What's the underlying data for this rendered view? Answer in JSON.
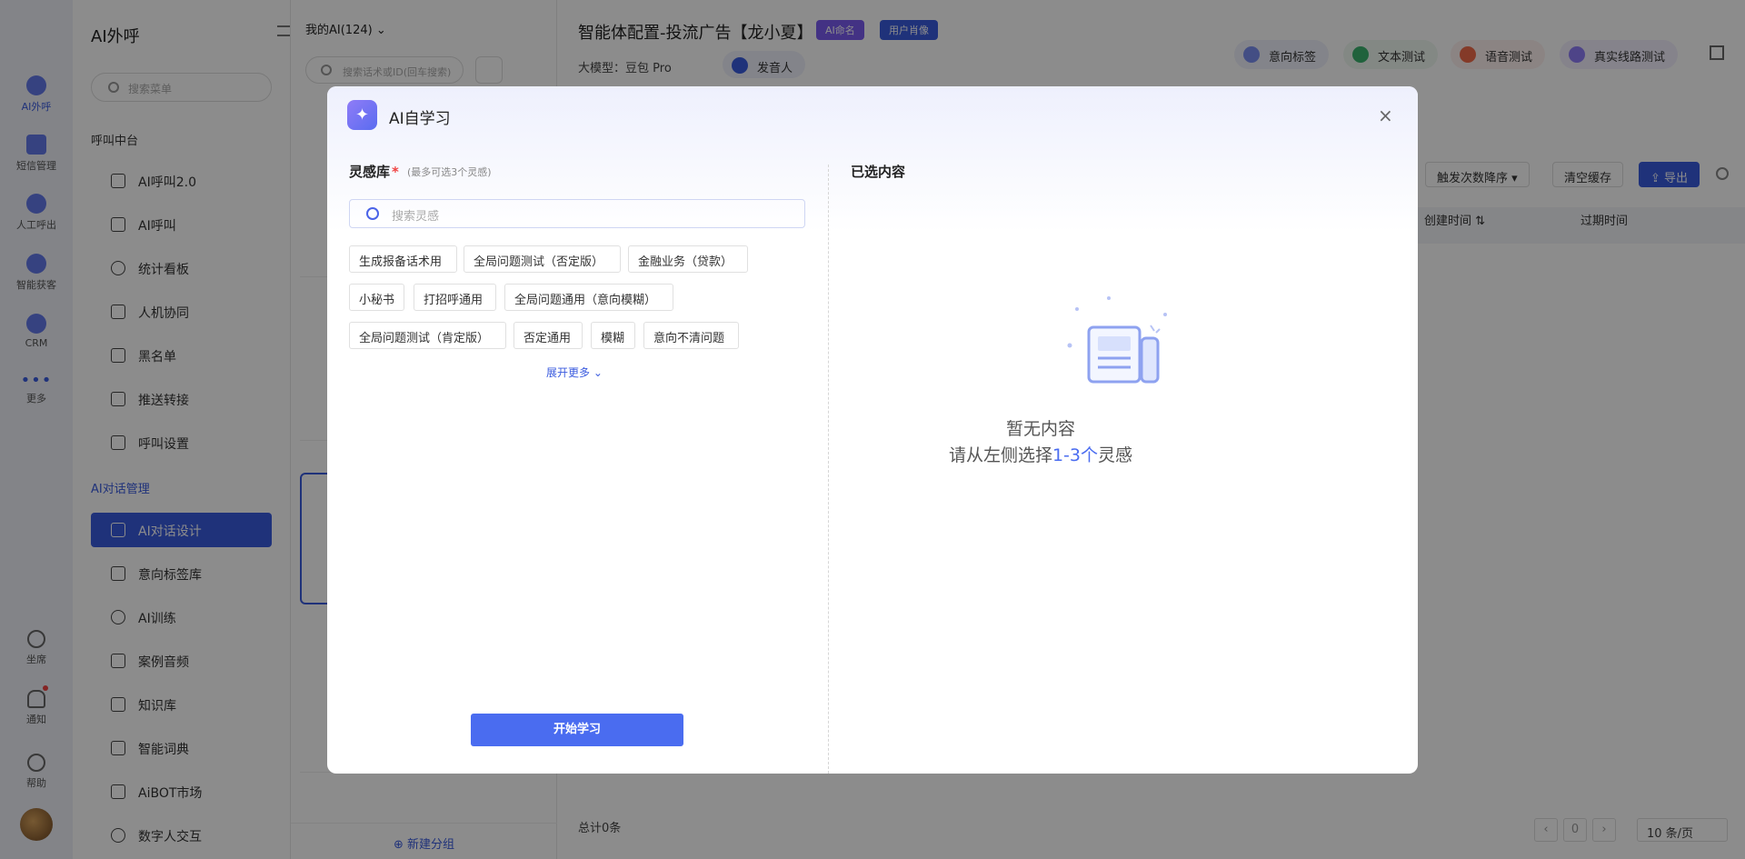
{
  "rail": {
    "items": [
      {
        "label": "AI外呼"
      },
      {
        "label": "短信管理"
      },
      {
        "label": "人工呼出"
      },
      {
        "label": "智能获客"
      },
      {
        "label": "CRM"
      },
      {
        "label": "更多"
      },
      {
        "label": "坐席"
      },
      {
        "label": "通知"
      },
      {
        "label": "帮助"
      }
    ]
  },
  "sidebar": {
    "title": "AI外呼",
    "search_placeholder": "搜索菜单",
    "section1": "呼叫中台",
    "items1": [
      "AI呼叫2.0",
      "AI呼叫",
      "统计看板",
      "人机协同",
      "黑名单",
      "推送转接",
      "呼叫设置"
    ],
    "section2": "AI对话管理",
    "items2": [
      "AI对话设计",
      "意向标签库",
      "AI训练",
      "案例音频",
      "知识库",
      "智能词典",
      "AiBOT市场",
      "数字人交互"
    ]
  },
  "listcol": {
    "header": "我的AI(124)",
    "search_placeholder": "搜索话术或ID(回车搜索)",
    "new_group": "新建分组"
  },
  "main": {
    "title": "智能体配置-投流广告【龙小夏】",
    "tag_ai_naming": "AI命名",
    "tag_user_portrait": "用户肖像",
    "model_label": "大模型：",
    "model_name": "豆包 Pro",
    "speaker": "发音人",
    "toolbar": [
      "意向标签",
      "文本测试",
      "语音测试",
      "真实线路测试"
    ],
    "sort_label": "触发次数降序",
    "clear_cache": "清空缓存",
    "export": "导出",
    "col_created": "创建时间",
    "col_expire": "过期时间",
    "total": "总计0条",
    "page_num": "0",
    "page_size": "10 条/页"
  },
  "modal": {
    "title": "AI自学习",
    "close": "×",
    "lib_label": "灵感库",
    "lib_required": "*",
    "lib_hint": "(最多可选3个灵感)",
    "search_placeholder": "搜索灵感",
    "chips": [
      "生成报备话术用",
      "全局问题测试（否定版）",
      "金融业务（贷款）",
      "小秘书",
      "打招呼通用",
      "全局问题通用（意向模糊）",
      "全局问题测试（肯定版）",
      "否定通用",
      "模糊",
      "意向不清问题"
    ],
    "expand": "展开更多",
    "start": "开始学习",
    "selected_label": "已选内容",
    "empty_title": "暂无内容",
    "empty_sub_pre": "请从左侧选择",
    "empty_sub_hl": "1-3个",
    "empty_sub_post": "灵感"
  },
  "colors": {
    "primary": "#4a6cf0",
    "sidebar_active": "#3a5bdf",
    "required": "#f04242"
  }
}
